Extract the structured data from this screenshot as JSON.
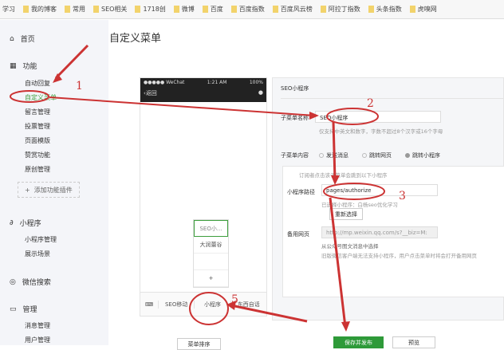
{
  "bookmarks": [
    "学习",
    "我的博客",
    "常用",
    "SEO相关",
    "1718创",
    "微博",
    "百度",
    "百度指数",
    "百度风云榜",
    "阿拉丁指数",
    "头条指数",
    "虎嗅网"
  ],
  "sidebar": {
    "home": "首页",
    "func": "功能",
    "func_items": [
      "自动回复",
      "自定义菜单",
      "留言管理",
      "投票管理",
      "页面模版",
      "赞赏功能",
      "原创管理"
    ],
    "add_plugin": "添加功能插件",
    "mini": "小程序",
    "mini_items": [
      "小程序管理",
      "展示场景"
    ],
    "search": "微信搜索",
    "manage": "管理",
    "manage_items": [
      "消息管理",
      "用户管理"
    ]
  },
  "page_title": "自定义菜单",
  "phone": {
    "carrier": "●●●●● WeChat",
    "time": "1:21 AM",
    "battery": "100%",
    "back": "返回",
    "submenu": [
      "SEO小...",
      "大润蕾谷",
      "",
      "+"
    ],
    "menu": [
      "SEO移动",
      "小程序",
      "东西自话"
    ]
  },
  "editor": {
    "header": "SEO小程序",
    "name_label": "子菜单名称",
    "name_value": "SEO小程序",
    "name_hint": "仅支持中英文和数字，字数不超过8个汉字或16个字母",
    "content_label": "子菜单内容",
    "options": [
      "发送消息",
      "跳转网页",
      "跳转小程序"
    ],
    "selected": 2,
    "mini_desc": "订阅者点击该子菜单会跳到以下小程序",
    "path_label": "小程序路径",
    "path_value": "pages/authorize",
    "selected_hint": "已选择小程序：白杨seo优化学习",
    "reselect": "重新选择",
    "backup_label": "备用网页",
    "backup_value": "http://mp.weixin.qq.com/s?__biz=M:",
    "backup_hint1": "从公众号图文消息中选择",
    "backup_hint2": "旧版微信客户端无法支持小程序，用户点击菜单时将会打开备用网页"
  },
  "buttons": {
    "sort": "菜单排序",
    "save": "保存并发布",
    "preview": "预览"
  },
  "annotations": [
    "1",
    "2",
    "3",
    "5"
  ],
  "colors": {
    "accent": "#2e9a39",
    "annotation": "#c33333"
  }
}
